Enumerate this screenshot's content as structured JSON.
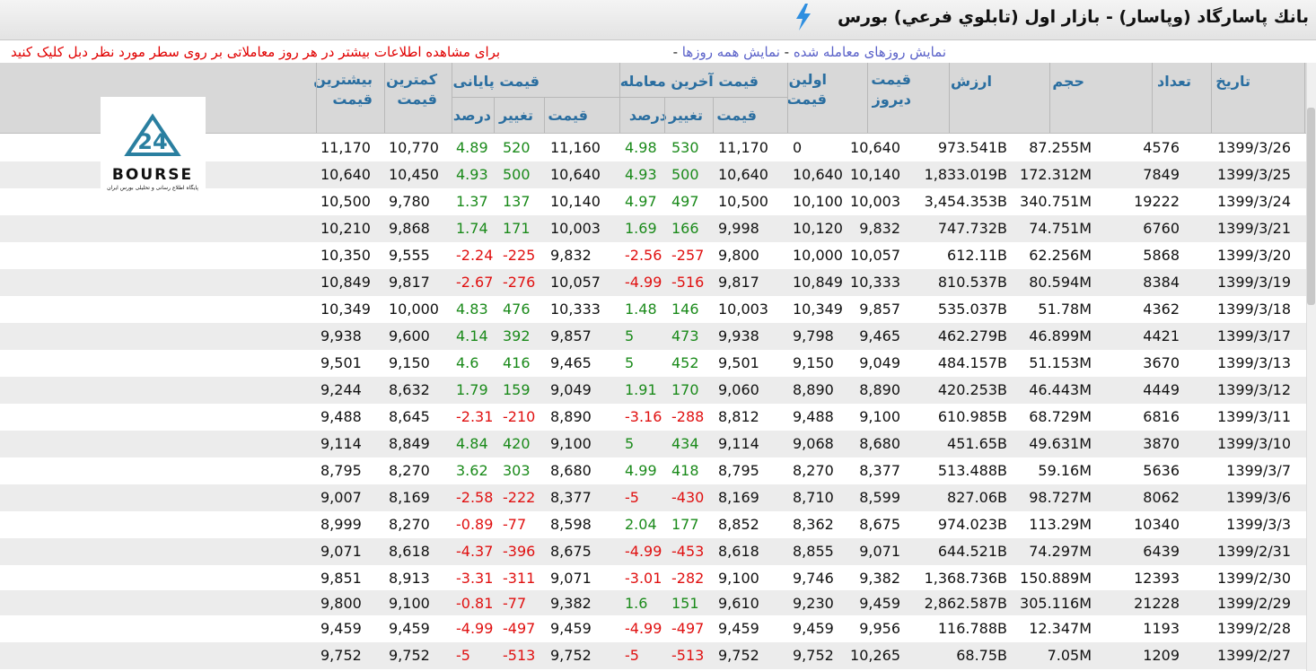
{
  "page_title": "بانك پاسارگاد (وپاسار) - بازار اول (تابلوي فرعي) بورس",
  "links": {
    "traded_days": "نمایش روزهای معامله شده",
    "all_days": "نمایش همه روزها",
    "info": "برای مشاهده اطلاعات بیشتر در هر روز معاملاتی بر روی سطر مورد نظر دبل کلیک کنید"
  },
  "logo": {
    "text": "BOURSE",
    "number": "24",
    "caption": "پایگاه اطلاع رسانی و تحلیلی بورس ایران"
  },
  "headers": {
    "date": "تاریخ",
    "count": "تعداد",
    "volume": "حجم",
    "value": "ارزش",
    "prev_1": "قیمت",
    "prev_2": "دیروز",
    "first_1": "اولین",
    "first_2": "قیمت",
    "last_group": "قیمت آخرین معامله",
    "close_group": "قیمت پایانی",
    "price": "قیمت",
    "change": "تغییر",
    "percent": "درصد",
    "low_1": "کمترین",
    "low_2": "قیمت",
    "high_1": "بیشترین",
    "high_2": "قیمت"
  },
  "rows": [
    {
      "date": "1399/3/26",
      "count": "4576",
      "volume": "87.255M",
      "value": "973.541B",
      "prev": "10,640",
      "first": "0",
      "last_price": "11,170",
      "last_change": "530",
      "last_pct": "4.98",
      "close_price": "11,160",
      "close_change": "520",
      "close_pct": "4.89",
      "low": "10,770",
      "high": "11,170",
      "sign": "pos"
    },
    {
      "date": "1399/3/25",
      "count": "7849",
      "volume": "172.312M",
      "value": "1,833.019B",
      "prev": "10,140",
      "first": "10,640",
      "last_price": "10,640",
      "last_change": "500",
      "last_pct": "4.93",
      "close_price": "10,640",
      "close_change": "500",
      "close_pct": "4.93",
      "low": "10,450",
      "high": "10,640",
      "sign": "pos"
    },
    {
      "date": "1399/3/24",
      "count": "19222",
      "volume": "340.751M",
      "value": "3,454.353B",
      "prev": "10,003",
      "first": "10,100",
      "last_price": "10,500",
      "last_change": "497",
      "last_pct": "4.97",
      "close_price": "10,140",
      "close_change": "137",
      "close_pct": "1.37",
      "low": "9,780",
      "high": "10,500",
      "sign": "pos"
    },
    {
      "date": "1399/3/21",
      "count": "6760",
      "volume": "74.751M",
      "value": "747.732B",
      "prev": "9,832",
      "first": "10,120",
      "last_price": "9,998",
      "last_change": "166",
      "last_pct": "1.69",
      "close_price": "10,003",
      "close_change": "171",
      "close_pct": "1.74",
      "low": "9,868",
      "high": "10,210",
      "sign": "pos"
    },
    {
      "date": "1399/3/20",
      "count": "5868",
      "volume": "62.256M",
      "value": "612.11B",
      "prev": "10,057",
      "first": "10,000",
      "last_price": "9,800",
      "last_change": "-257",
      "last_pct": "-2.56",
      "close_price": "9,832",
      "close_change": "-225",
      "close_pct": "-2.24",
      "low": "9,555",
      "high": "10,350",
      "sign": "neg"
    },
    {
      "date": "1399/3/19",
      "count": "8384",
      "volume": "80.594M",
      "value": "810.537B",
      "prev": "10,333",
      "first": "10,849",
      "last_price": "9,817",
      "last_change": "-516",
      "last_pct": "-4.99",
      "close_price": "10,057",
      "close_change": "-276",
      "close_pct": "-2.67",
      "low": "9,817",
      "high": "10,849",
      "sign": "neg"
    },
    {
      "date": "1399/3/18",
      "count": "4362",
      "volume": "51.78M",
      "value": "535.037B",
      "prev": "9,857",
      "first": "10,349",
      "last_price": "10,003",
      "last_change": "146",
      "last_pct": "1.48",
      "close_price": "10,333",
      "close_change": "476",
      "close_pct": "4.83",
      "low": "10,000",
      "high": "10,349",
      "sign": "pos"
    },
    {
      "date": "1399/3/17",
      "count": "4421",
      "volume": "46.899M",
      "value": "462.279B",
      "prev": "9,465",
      "first": "9,798",
      "last_price": "9,938",
      "last_change": "473",
      "last_pct": "5",
      "close_price": "9,857",
      "close_change": "392",
      "close_pct": "4.14",
      "low": "9,600",
      "high": "9,938",
      "sign": "pos"
    },
    {
      "date": "1399/3/13",
      "count": "3670",
      "volume": "51.153M",
      "value": "484.157B",
      "prev": "9,049",
      "first": "9,150",
      "last_price": "9,501",
      "last_change": "452",
      "last_pct": "5",
      "close_price": "9,465",
      "close_change": "416",
      "close_pct": "4.6",
      "low": "9,150",
      "high": "9,501",
      "sign": "pos"
    },
    {
      "date": "1399/3/12",
      "count": "4449",
      "volume": "46.443M",
      "value": "420.253B",
      "prev": "8,890",
      "first": "8,890",
      "last_price": "9,060",
      "last_change": "170",
      "last_pct": "1.91",
      "close_price": "9,049",
      "close_change": "159",
      "close_pct": "1.79",
      "low": "8,632",
      "high": "9,244",
      "sign": "pos"
    },
    {
      "date": "1399/3/11",
      "count": "6816",
      "volume": "68.729M",
      "value": "610.985B",
      "prev": "9,100",
      "first": "9,488",
      "last_price": "8,812",
      "last_change": "-288",
      "last_pct": "-3.16",
      "close_price": "8,890",
      "close_change": "-210",
      "close_pct": "-2.31",
      "low": "8,645",
      "high": "9,488",
      "sign": "neg"
    },
    {
      "date": "1399/3/10",
      "count": "3870",
      "volume": "49.631M",
      "value": "451.65B",
      "prev": "8,680",
      "first": "9,068",
      "last_price": "9,114",
      "last_change": "434",
      "last_pct": "5",
      "close_price": "9,100",
      "close_change": "420",
      "close_pct": "4.84",
      "low": "8,849",
      "high": "9,114",
      "sign": "pos"
    },
    {
      "date": "1399/3/7",
      "count": "5636",
      "volume": "59.16M",
      "value": "513.488B",
      "prev": "8,377",
      "first": "8,270",
      "last_price": "8,795",
      "last_change": "418",
      "last_pct": "4.99",
      "close_price": "8,680",
      "close_change": "303",
      "close_pct": "3.62",
      "low": "8,270",
      "high": "8,795",
      "sign": "pos"
    },
    {
      "date": "1399/3/6",
      "count": "8062",
      "volume": "98.727M",
      "value": "827.06B",
      "prev": "8,599",
      "first": "8,710",
      "last_price": "8,169",
      "last_change": "-430",
      "last_pct": "-5",
      "close_price": "8,377",
      "close_change": "-222",
      "close_pct": "-2.58",
      "low": "8,169",
      "high": "9,007",
      "sign": "neg"
    },
    {
      "date": "1399/3/3",
      "count": "10340",
      "volume": "113.29M",
      "value": "974.023B",
      "prev": "8,675",
      "first": "8,362",
      "last_price": "8,852",
      "last_change": "177",
      "last_pct": "2.04",
      "close_price": "8,598",
      "close_change": "-77",
      "close_pct": "-0.89",
      "low": "8,270",
      "high": "8,999",
      "sign": "mixed"
    },
    {
      "date": "1399/2/31",
      "count": "6439",
      "volume": "74.297M",
      "value": "644.521B",
      "prev": "9,071",
      "first": "8,855",
      "last_price": "8,618",
      "last_change": "-453",
      "last_pct": "-4.99",
      "close_price": "8,675",
      "close_change": "-396",
      "close_pct": "-4.37",
      "low": "8,618",
      "high": "9,071",
      "sign": "neg"
    },
    {
      "date": "1399/2/30",
      "count": "12393",
      "volume": "150.889M",
      "value": "1,368.736B",
      "prev": "9,382",
      "first": "9,746",
      "last_price": "9,100",
      "last_change": "-282",
      "last_pct": "-3.01",
      "close_price": "9,071",
      "close_change": "-311",
      "close_pct": "-3.31",
      "low": "8,913",
      "high": "9,851",
      "sign": "neg"
    },
    {
      "date": "1399/2/29",
      "count": "21228",
      "volume": "305.116M",
      "value": "2,862.587B",
      "prev": "9,459",
      "first": "9,230",
      "last_price": "9,610",
      "last_change": "151",
      "last_pct": "1.6",
      "close_price": "9,382",
      "close_change": "-77",
      "close_pct": "-0.81",
      "low": "9,100",
      "high": "9,800",
      "sign": "mixed"
    },
    {
      "date": "1399/2/28",
      "count": "1193",
      "volume": "12.347M",
      "value": "116.788B",
      "prev": "9,956",
      "first": "9,459",
      "last_price": "9,459",
      "last_change": "-497",
      "last_pct": "-4.99",
      "close_price": "9,459",
      "close_change": "-497",
      "close_pct": "-4.99",
      "low": "9,459",
      "high": "9,459",
      "sign": "neg"
    },
    {
      "date": "1399/2/27",
      "count": "1209",
      "volume": "7.05M",
      "value": "68.75B",
      "prev": "10,265",
      "first": "9,752",
      "last_price": "9,752",
      "last_change": "-513",
      "last_pct": "-5",
      "close_price": "9,752",
      "close_change": "-513",
      "close_pct": "-5",
      "low": "9,752",
      "high": "9,752",
      "sign": "neg"
    }
  ]
}
